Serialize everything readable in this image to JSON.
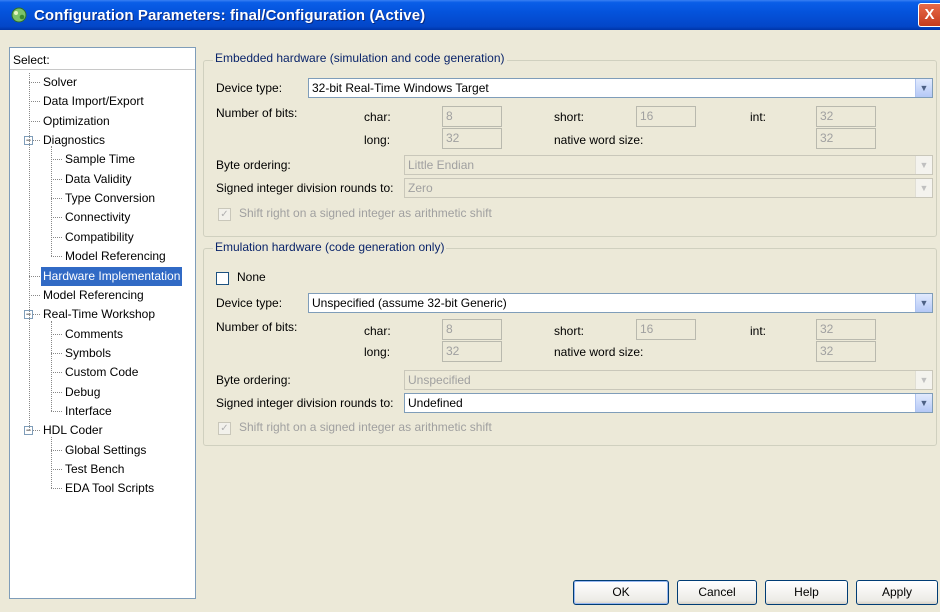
{
  "window": {
    "title": "Configuration Parameters: final/Configuration (Active)",
    "close_glyph": "X",
    "icon": "simulink-config-icon"
  },
  "tree": {
    "header": "Select:",
    "items": [
      {
        "label": "Solver"
      },
      {
        "label": "Data Import/Export"
      },
      {
        "label": "Optimization"
      },
      {
        "label": "Diagnostics",
        "expander": "−"
      },
      {
        "label": "Sample Time"
      },
      {
        "label": "Data Validity"
      },
      {
        "label": "Type Conversion"
      },
      {
        "label": "Connectivity"
      },
      {
        "label": "Compatibility"
      },
      {
        "label": "Model Referencing"
      },
      {
        "label": "Hardware Implementation",
        "selected": true
      },
      {
        "label": "Model Referencing"
      },
      {
        "label": "Real-Time Workshop",
        "expander": "−"
      },
      {
        "label": "Comments"
      },
      {
        "label": "Symbols"
      },
      {
        "label": "Custom Code"
      },
      {
        "label": "Debug"
      },
      {
        "label": "Interface"
      },
      {
        "label": "HDL Coder",
        "expander": "−"
      },
      {
        "label": "Global Settings"
      },
      {
        "label": "Test Bench"
      },
      {
        "label": "EDA Tool Scripts"
      }
    ]
  },
  "embedded": {
    "title": "Embedded hardware (simulation and code generation)",
    "device_type_label": "Device type:",
    "device_type_value": "32-bit Real-Time Windows Target",
    "num_bits_label": "Number of bits:",
    "char_label": "char:",
    "char_value": "8",
    "short_label": "short:",
    "short_value": "16",
    "int_label": "int:",
    "int_value": "32",
    "long_label": "long:",
    "long_value": "32",
    "native_label": "native word size:",
    "native_value": "32",
    "byte_order_label": "Byte ordering:",
    "byte_order_value": "Little Endian",
    "signed_div_label": "Signed integer division rounds to:",
    "signed_div_value": "Zero",
    "shift_label": "Shift right on a signed integer as arithmetic shift",
    "shift_checked": true
  },
  "emulation": {
    "title": "Emulation hardware (code generation only)",
    "none_label": "None",
    "none_checked": false,
    "device_type_label": "Device type:",
    "device_type_value": "Unspecified (assume 32-bit Generic)",
    "num_bits_label": "Number of bits:",
    "char_label": "char:",
    "char_value": "8",
    "short_label": "short:",
    "short_value": "16",
    "int_label": "int:",
    "int_value": "32",
    "long_label": "long:",
    "long_value": "32",
    "native_label": "native word size:",
    "native_value": "32",
    "byte_order_label": "Byte ordering:",
    "byte_order_value": "Unspecified",
    "signed_div_label": "Signed integer division rounds to:",
    "signed_div_value": "Undefined",
    "shift_label": "Shift right on a signed integer as arithmetic shift",
    "shift_checked": true
  },
  "buttons": {
    "ok": "OK",
    "cancel": "Cancel",
    "help": "Help",
    "apply": "Apply"
  },
  "glyphs": {
    "dropdown_arrow": "▼",
    "check": "✓"
  }
}
